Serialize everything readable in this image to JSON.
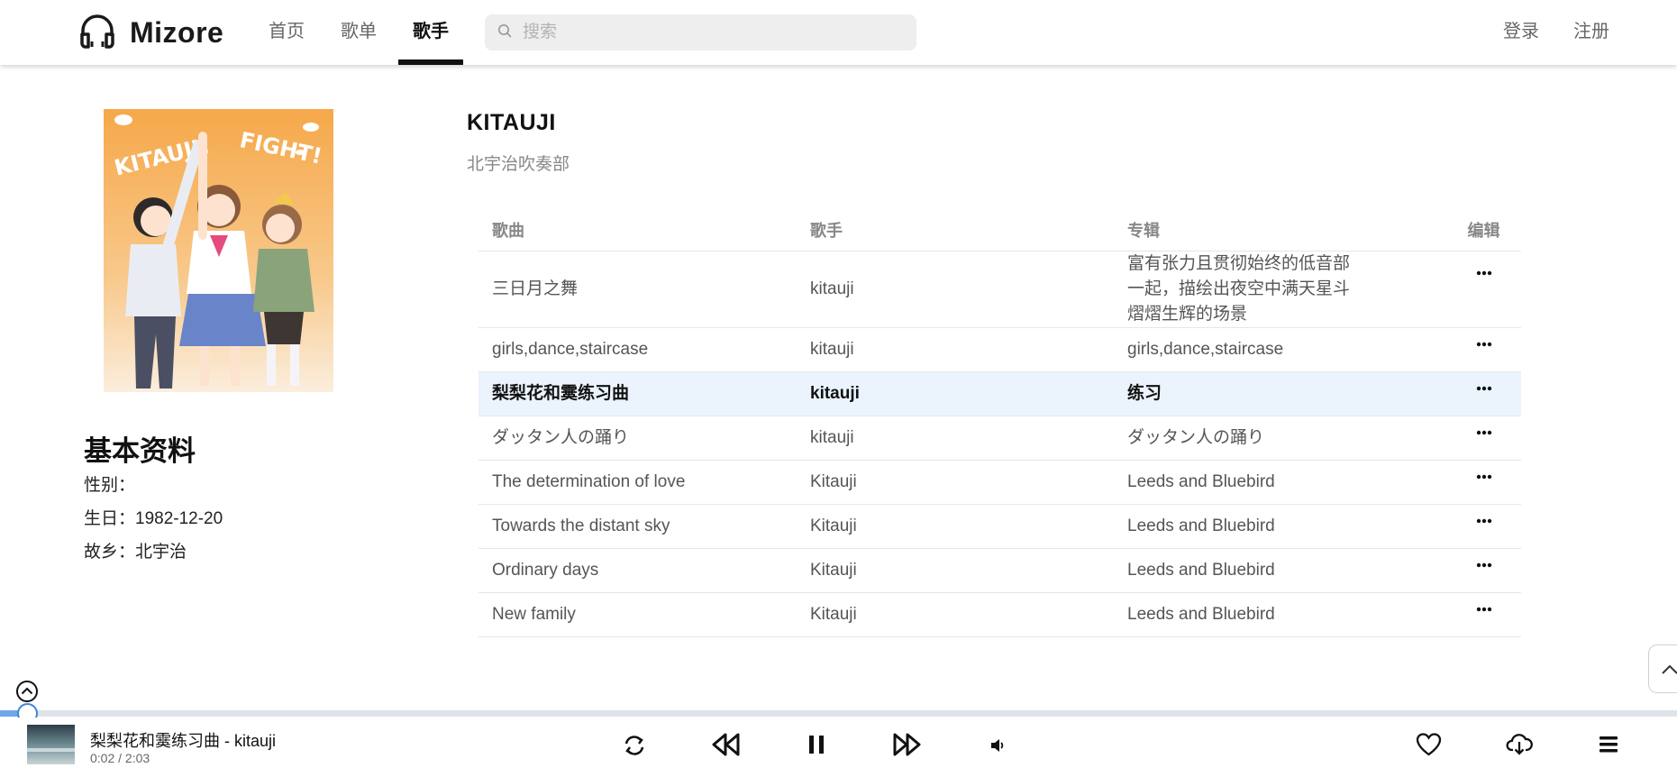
{
  "app": {
    "name": "Mizore"
  },
  "nav": [
    {
      "label": "首页"
    },
    {
      "label": "歌单"
    },
    {
      "label": "歌手"
    }
  ],
  "search": {
    "placeholder": "搜索"
  },
  "auth": {
    "login": "登录",
    "register": "注册"
  },
  "artist": {
    "name": "KITAUJI",
    "subtitle": "北宇治吹奏部"
  },
  "cover": {
    "text_left": "KITAUJI!",
    "text_right": "FIGHT!"
  },
  "profile": {
    "title": "基本资料",
    "gender": "性别：",
    "birthday": "生日：1982-12-20",
    "hometown": "故乡：北宇治"
  },
  "table": {
    "headers": {
      "song": "歌曲",
      "artist": "歌手",
      "album": "专辑",
      "edit": "编辑"
    },
    "rows": [
      {
        "song": "三日月之舞",
        "artist": "kitauji",
        "album": "富有张力且贯彻始终的低音部一起，描绘出夜空中满天星斗熠熠生辉的场景"
      },
      {
        "song": "girls,dance,staircase",
        "artist": "kitauji",
        "album": "girls,dance,staircase"
      },
      {
        "song": "梨梨花和霙练习曲",
        "artist": "kitauji",
        "album": "练习"
      },
      {
        "song": "ダッタン人の踊り",
        "artist": "kitauji",
        "album": "ダッタン人の踊り"
      },
      {
        "song": "The determination of love",
        "artist": "Kitauji",
        "album": "Leeds and Bluebird"
      },
      {
        "song": "Towards the distant sky",
        "artist": "Kitauji",
        "album": "Leeds and Bluebird"
      },
      {
        "song": "Ordinary days",
        "artist": "Kitauji",
        "album": "Leeds and Bluebird"
      },
      {
        "song": "New family",
        "artist": "Kitauji",
        "album": "Leeds and Bluebird"
      }
    ]
  },
  "player": {
    "now_playing": "梨梨花和霙练习曲 - kitauji",
    "time": "0:02 / 2:03",
    "progress_fraction": 0.016,
    "accent": "#3d86d8"
  },
  "icons": [
    "headphones-icon",
    "search-icon",
    "more-icon",
    "chevron-up-icon",
    "collapse-icon",
    "repeat-icon",
    "previous-icon",
    "pause-icon",
    "next-icon",
    "volume-icon",
    "heart-icon",
    "download-icon",
    "playlist-icon"
  ]
}
